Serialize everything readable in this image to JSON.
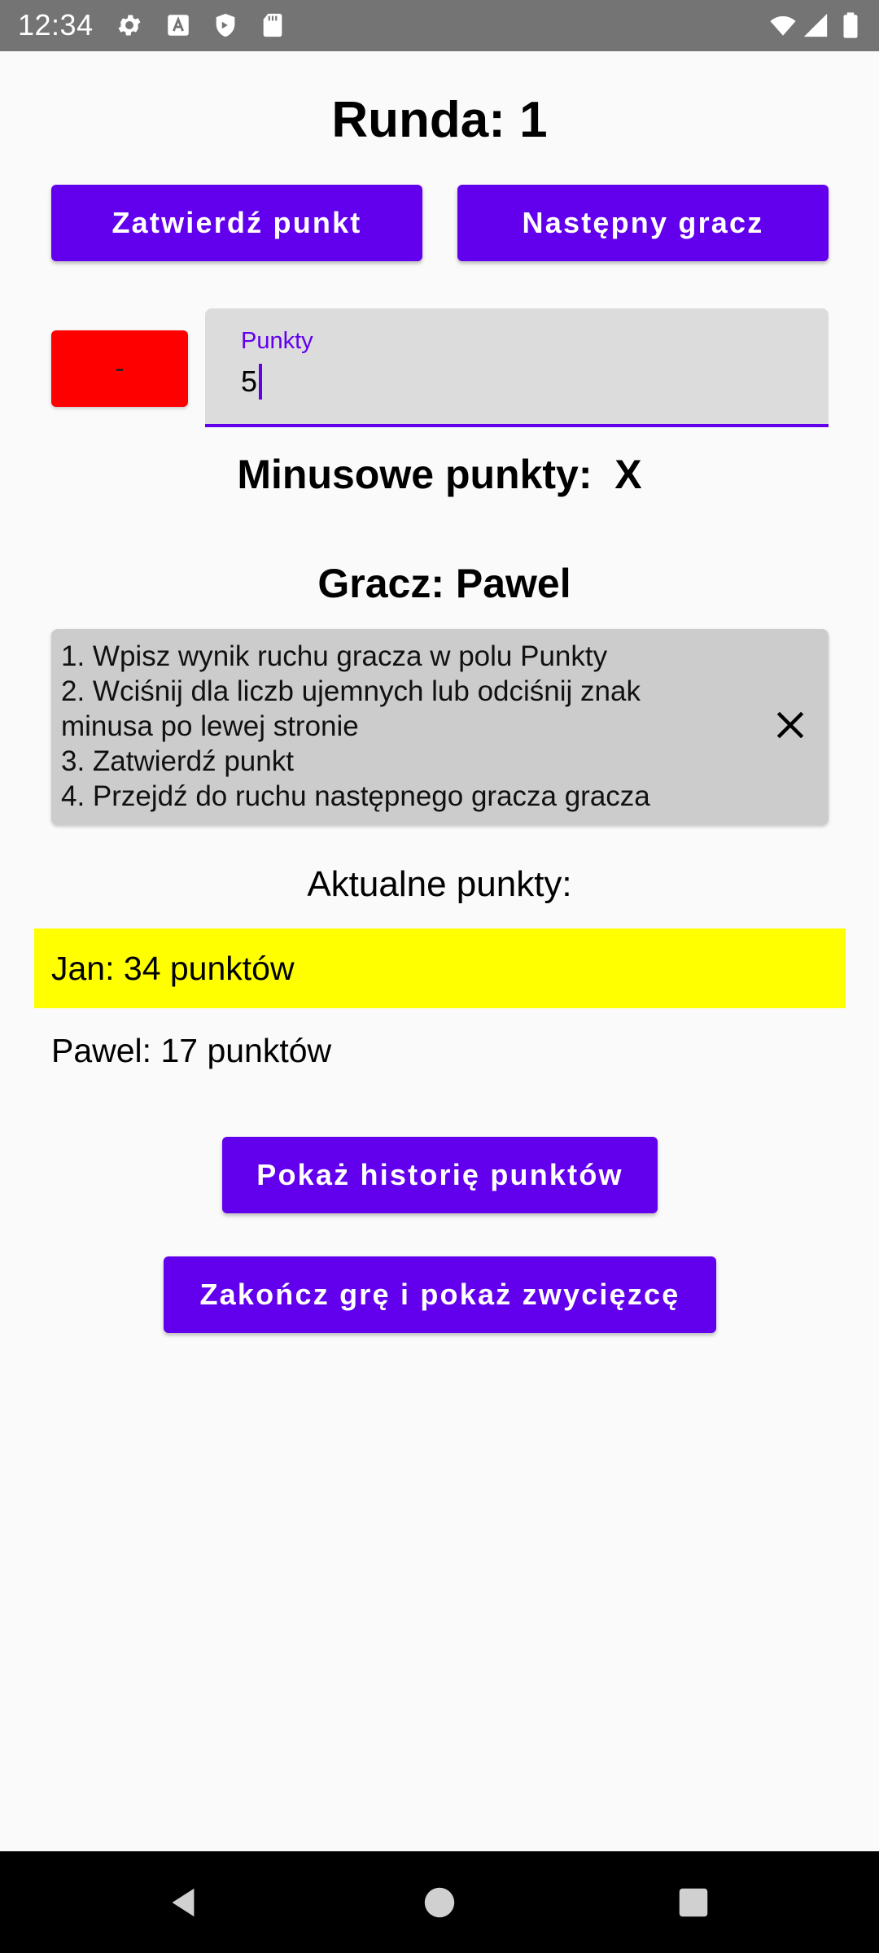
{
  "status_bar": {
    "time": "12:34",
    "icons": [
      "gear-icon",
      "font-a-icon",
      "shield-icon",
      "sd-card-icon",
      "wifi-icon",
      "signal-icon",
      "battery-icon"
    ]
  },
  "round": {
    "title": "Runda: 1"
  },
  "buttons": {
    "confirm": "Zatwierdź punkt",
    "next_player": "Następny gracz",
    "show_history": "Pokaż historię punktów",
    "end_game": "Zakończ grę i pokaż zwycięzcę"
  },
  "minus_toggle": {
    "label": "-",
    "color": "#ff0000"
  },
  "points_input": {
    "label": "Punkty",
    "value": "5"
  },
  "minus_points": {
    "text": "Minusowe punkty:  X"
  },
  "player": {
    "title": "Gracz: Pawel"
  },
  "instructions": {
    "lines": [
      "1. Wpisz wynik ruchu gracza w polu Punkty",
      "2. Wciśnij dla liczb ujemnych lub odciśnij znak",
      "minusa po lewej stronie",
      "3. Zatwierdź punkt",
      "4. Przejdź do ruchu następnego gracza gracza"
    ],
    "close_icon": "close-icon"
  },
  "scores": {
    "title": "Aktualne punkty:",
    "rows": [
      {
        "text": "Jan: 34 punktów",
        "highlighted": true
      },
      {
        "text": "Pawel: 17 punktów",
        "highlighted": false
      }
    ]
  },
  "colors": {
    "accent": "#6200ee",
    "highlight": "#ffff00",
    "minus": "#ff0000"
  },
  "nav_bar": {
    "icons": [
      "back-icon",
      "home-icon",
      "recents-icon"
    ]
  }
}
